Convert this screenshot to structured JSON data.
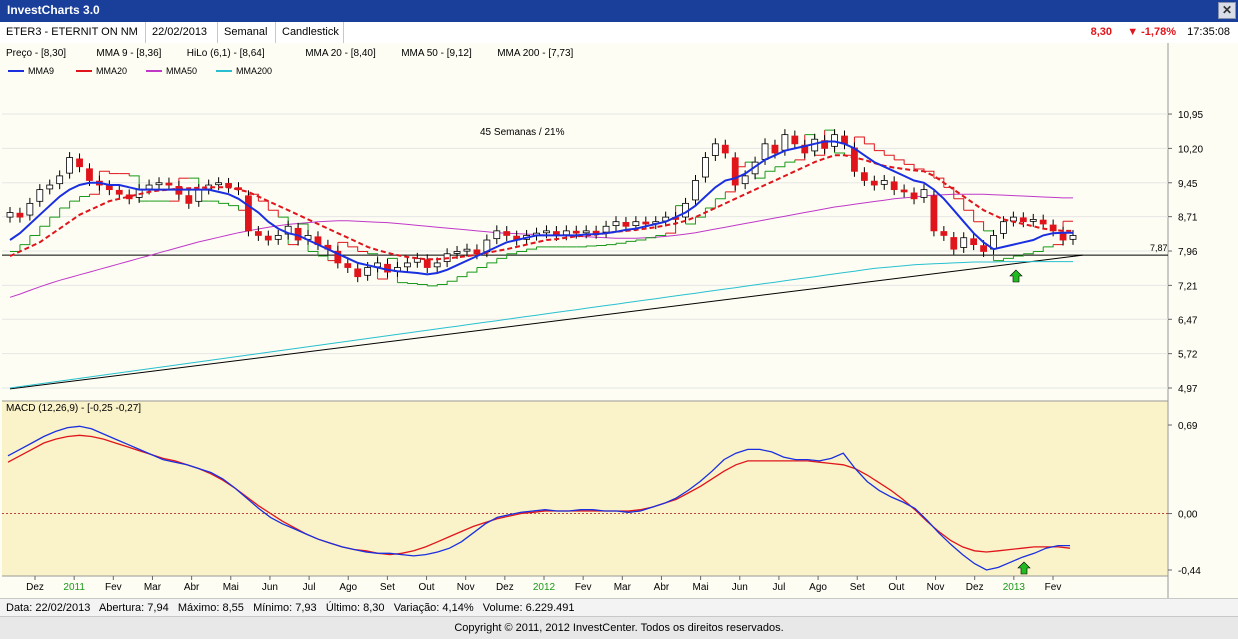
{
  "app": {
    "title": "InvestCharts 3.0",
    "close_glyph": "✕"
  },
  "toolbar": {
    "ticker": "ETER3 - ETERNIT ON NM",
    "date": "22/02/2013",
    "period": "Semanal",
    "chart_type": "Candlestick",
    "price": "8,30",
    "change": "▼ -1,78%",
    "time": "17:35:08"
  },
  "indicators_line": [
    "Preço - [8,30]",
    "MMA 9 - [8,36]",
    "HiLo (6,1) - [8,64]",
    "MMA 20 - [8,40]",
    "MMA 50 - [9,12]",
    "MMA 200 - [7,73]"
  ],
  "info_bar": {
    "data": "Data: 22/02/2013",
    "abertura": "Abertura: 7,94",
    "maximo": "Máximo: 8,55",
    "minimo": "Mínimo: 7,93",
    "ultimo": "Último: 8,30",
    "variacao": "Variação: 4,14%",
    "volume": "Volume: 6.229.491"
  },
  "copyright": "Copyright © 2011, 2012 InvestCenter. Todos os direitos reservados.",
  "colors": {
    "up": "#ffffff",
    "down": "#e0141b",
    "mma9": "#1a2fe0",
    "mma20": "#e0141b",
    "mma50": "#c038c8",
    "mma200": "#28c0d0",
    "hilo_up": "#1a9a1a",
    "hilo_down": "#e0141b",
    "macd": "#1a2fe0",
    "signal": "#e0141b",
    "accent": "#22bb22"
  },
  "chart_data": [
    {
      "type": "candlestick",
      "title": "",
      "legend": [
        {
          "name": "MMA9",
          "color": "#1a2fe0"
        },
        {
          "name": "MMA20",
          "color": "#e0141b"
        },
        {
          "name": "MMA50",
          "color": "#c038c8"
        },
        {
          "name": "MMA200",
          "color": "#28c0d0"
        }
      ],
      "annotation": "45 Semanas / 21%",
      "hline_label": "7,87",
      "hline_value": 7.87,
      "y_ticks": [
        "10,95",
        "10,20",
        "9,45",
        "8,71",
        "7,96",
        "7,21",
        "6,47",
        "5,72",
        "4,97"
      ],
      "ylim": [
        4.97,
        11.3
      ],
      "trendline": [
        [
          0,
          4.95
        ],
        [
          108,
          7.87
        ]
      ],
      "close": [
        8.8,
        8.7,
        9.0,
        9.3,
        9.4,
        9.6,
        10.0,
        9.8,
        9.5,
        9.4,
        9.3,
        9.2,
        9.1,
        9.3,
        9.4,
        9.45,
        9.4,
        9.2,
        9.0,
        9.3,
        9.4,
        9.45,
        9.35,
        9.3,
        8.4,
        8.3,
        8.2,
        8.3,
        8.5,
        8.2,
        8.3,
        8.1,
        8.0,
        7.7,
        7.6,
        7.4,
        7.6,
        7.7,
        7.5,
        7.6,
        7.7,
        7.8,
        7.6,
        7.7,
        7.9,
        7.95,
        8.0,
        7.9,
        8.2,
        8.4,
        8.3,
        8.2,
        8.3,
        8.35,
        8.4,
        8.3,
        8.4,
        8.35,
        8.4,
        8.35,
        8.5,
        8.6,
        8.5,
        8.6,
        8.55,
        8.6,
        8.7,
        8.65,
        9.0,
        9.5,
        10.0,
        10.3,
        10.1,
        9.4,
        9.6,
        9.9,
        10.3,
        10.1,
        10.5,
        10.3,
        10.1,
        10.4,
        10.2,
        10.5,
        10.3,
        9.7,
        9.5,
        9.4,
        9.5,
        9.3,
        9.25,
        9.1,
        9.3,
        8.4,
        8.3,
        8.0,
        8.25,
        8.1,
        7.95,
        8.3,
        8.6,
        8.7,
        8.6,
        8.65,
        8.55,
        8.4,
        8.2,
        8.3
      ],
      "mma9": [
        8.2,
        8.35,
        8.55,
        8.75,
        8.95,
        9.15,
        9.3,
        9.4,
        9.45,
        9.45,
        9.4,
        9.4,
        9.35,
        9.3,
        9.3,
        9.3,
        9.3,
        9.3,
        9.3,
        9.3,
        9.3,
        9.25,
        9.2,
        9.1,
        8.95,
        8.8,
        8.6,
        8.45,
        8.35,
        8.3,
        8.2,
        8.1,
        8.0,
        7.9,
        7.8,
        7.7,
        7.65,
        7.6,
        7.55,
        7.52,
        7.5,
        7.48,
        7.45,
        7.48,
        7.55,
        7.65,
        7.75,
        7.85,
        7.95,
        8.05,
        8.15,
        8.2,
        8.25,
        8.3,
        8.3,
        8.3,
        8.3,
        8.3,
        8.32,
        8.33,
        8.35,
        8.38,
        8.42,
        8.45,
        8.5,
        8.55,
        8.6,
        8.7,
        8.8,
        8.95,
        9.15,
        9.35,
        9.5,
        9.55,
        9.65,
        9.8,
        9.95,
        10.05,
        10.15,
        10.2,
        10.25,
        10.3,
        10.35,
        10.35,
        10.3,
        10.2,
        10.05,
        9.9,
        9.8,
        9.7,
        9.6,
        9.5,
        9.45,
        9.3,
        9.1,
        8.85,
        8.6,
        8.35,
        8.15,
        8.0,
        8.05,
        8.1,
        8.15,
        8.2,
        8.3,
        8.35,
        8.36,
        8.36
      ],
      "mma20": [
        7.85,
        7.95,
        8.05,
        8.15,
        8.3,
        8.45,
        8.6,
        8.75,
        8.85,
        8.95,
        9.05,
        9.1,
        9.15,
        9.2,
        9.25,
        9.28,
        9.3,
        9.32,
        9.33,
        9.34,
        9.35,
        9.35,
        9.35,
        9.3,
        9.25,
        9.15,
        9.05,
        8.95,
        8.85,
        8.75,
        8.65,
        8.55,
        8.45,
        8.35,
        8.25,
        8.15,
        8.05,
        7.98,
        7.92,
        7.87,
        7.83,
        7.8,
        7.78,
        7.78,
        7.8,
        7.82,
        7.85,
        7.88,
        7.92,
        7.96,
        8.0,
        8.05,
        8.1,
        8.15,
        8.2,
        8.22,
        8.25,
        8.28,
        8.3,
        8.32,
        8.35,
        8.38,
        8.4,
        8.42,
        8.45,
        8.48,
        8.52,
        8.56,
        8.62,
        8.7,
        8.8,
        8.9,
        9.0,
        9.1,
        9.2,
        9.3,
        9.4,
        9.5,
        9.6,
        9.7,
        9.8,
        9.9,
        9.98,
        10.05,
        10.05,
        10.0,
        9.95,
        9.88,
        9.82,
        9.78,
        9.75,
        9.72,
        9.7,
        9.6,
        9.45,
        9.3,
        9.15,
        9.0,
        8.85,
        8.75,
        8.65,
        8.6,
        8.55,
        8.5,
        8.45,
        8.42,
        8.4,
        8.4
      ],
      "mma50": [
        6.95,
        7.02,
        7.1,
        7.18,
        7.25,
        7.32,
        7.38,
        7.44,
        7.5,
        7.56,
        7.62,
        7.68,
        7.74,
        7.8,
        7.86,
        7.92,
        7.98,
        8.04,
        8.1,
        8.16,
        8.21,
        8.26,
        8.31,
        8.36,
        8.4,
        8.44,
        8.48,
        8.51,
        8.54,
        8.56,
        8.58,
        8.6,
        8.61,
        8.62,
        8.62,
        8.61,
        8.6,
        8.59,
        8.58,
        8.56,
        8.54,
        8.52,
        8.5,
        8.48,
        8.46,
        8.44,
        8.42,
        8.4,
        8.38,
        8.36,
        8.35,
        8.34,
        8.33,
        8.32,
        8.31,
        8.3,
        8.29,
        8.28,
        8.27,
        8.26,
        8.25,
        8.24,
        8.24,
        8.24,
        8.25,
        8.26,
        8.28,
        8.3,
        8.33,
        8.36,
        8.4,
        8.44,
        8.48,
        8.52,
        8.56,
        8.6,
        8.64,
        8.68,
        8.72,
        8.76,
        8.8,
        8.84,
        8.88,
        8.92,
        8.95,
        8.98,
        9.01,
        9.04,
        9.07,
        9.1,
        9.12,
        9.14,
        9.16,
        9.18,
        9.19,
        9.2,
        9.2,
        9.2,
        9.2,
        9.19,
        9.18,
        9.17,
        9.16,
        9.15,
        9.14,
        9.13,
        9.12,
        9.12
      ],
      "mma200": [
        4.97,
        5.0,
        5.03,
        5.06,
        5.09,
        5.12,
        5.15,
        5.18,
        5.21,
        5.24,
        5.27,
        5.3,
        5.33,
        5.36,
        5.39,
        5.42,
        5.45,
        5.48,
        5.51,
        5.54,
        5.57,
        5.6,
        5.63,
        5.66,
        5.69,
        5.72,
        5.75,
        5.78,
        5.81,
        5.84,
        5.87,
        5.9,
        5.93,
        5.96,
        5.99,
        6.02,
        6.05,
        6.08,
        6.11,
        6.14,
        6.17,
        6.2,
        6.23,
        6.26,
        6.29,
        6.32,
        6.35,
        6.38,
        6.41,
        6.44,
        6.47,
        6.5,
        6.53,
        6.56,
        6.59,
        6.62,
        6.65,
        6.68,
        6.71,
        6.74,
        6.77,
        6.8,
        6.83,
        6.86,
        6.89,
        6.92,
        6.95,
        6.98,
        7.01,
        7.04,
        7.07,
        7.1,
        7.13,
        7.16,
        7.19,
        7.22,
        7.25,
        7.28,
        7.31,
        7.34,
        7.37,
        7.4,
        7.43,
        7.46,
        7.49,
        7.52,
        7.55,
        7.58,
        7.6,
        7.62,
        7.64,
        7.66,
        7.67,
        7.68,
        7.69,
        7.7,
        7.71,
        7.72,
        7.72,
        7.72,
        7.73,
        7.73,
        7.73,
        7.73,
        7.73,
        7.73,
        7.73,
        7.73
      ]
    },
    {
      "type": "line",
      "title": "MACD (12,26,9) - [-0,25  -0,27]",
      "y_ticks": [
        "0,69",
        "0,00",
        "-0,44"
      ],
      "ylim": [
        -0.44,
        0.69
      ],
      "series": [
        {
          "name": "MACD",
          "values": [
            0.45,
            0.5,
            0.55,
            0.6,
            0.64,
            0.67,
            0.68,
            0.66,
            0.62,
            0.58,
            0.54,
            0.5,
            0.46,
            0.42,
            0.4,
            0.38,
            0.35,
            0.32,
            0.27,
            0.2,
            0.12,
            0.04,
            -0.03,
            -0.08,
            -0.12,
            -0.16,
            -0.2,
            -0.23,
            -0.26,
            -0.28,
            -0.3,
            -0.31,
            -0.31,
            -0.32,
            -0.33,
            -0.32,
            -0.3,
            -0.27,
            -0.22,
            -0.15,
            -0.08,
            -0.03,
            -0.01,
            0.01,
            0.02,
            0.03,
            0.02,
            0.02,
            0.03,
            0.03,
            0.02,
            0.02,
            0.01,
            0.02,
            0.05,
            0.08,
            0.12,
            0.18,
            0.25,
            0.33,
            0.42,
            0.47,
            0.5,
            0.5,
            0.48,
            0.44,
            0.42,
            0.42,
            0.41,
            0.43,
            0.47,
            0.35,
            0.25,
            0.18,
            0.13,
            0.09,
            0.04,
            -0.05,
            -0.15,
            -0.24,
            -0.32,
            -0.39,
            -0.44,
            -0.42,
            -0.38,
            -0.34,
            -0.31,
            -0.27,
            -0.25,
            -0.25
          ]
        },
        {
          "name": "Signal",
          "values": [
            0.4,
            0.45,
            0.5,
            0.55,
            0.58,
            0.6,
            0.61,
            0.6,
            0.58,
            0.55,
            0.52,
            0.49,
            0.46,
            0.43,
            0.41,
            0.38,
            0.35,
            0.31,
            0.26,
            0.2,
            0.13,
            0.06,
            0.0,
            -0.06,
            -0.11,
            -0.16,
            -0.2,
            -0.23,
            -0.26,
            -0.28,
            -0.29,
            -0.31,
            -0.32,
            -0.31,
            -0.29,
            -0.26,
            -0.22,
            -0.18,
            -0.14,
            -0.1,
            -0.07,
            -0.04,
            -0.02,
            0.0,
            0.01,
            0.02,
            0.02,
            0.02,
            0.02,
            0.02,
            0.02,
            0.02,
            0.02,
            0.03,
            0.05,
            0.08,
            0.11,
            0.16,
            0.21,
            0.27,
            0.33,
            0.38,
            0.41,
            0.41,
            0.41,
            0.41,
            0.41,
            0.41,
            0.4,
            0.39,
            0.38,
            0.35,
            0.3,
            0.24,
            0.18,
            0.11,
            0.03,
            -0.06,
            -0.14,
            -0.21,
            -0.26,
            -0.29,
            -0.3,
            -0.29,
            -0.28,
            -0.27,
            -0.26,
            -0.26,
            -0.26,
            -0.27
          ]
        }
      ]
    }
  ],
  "x_axis": [
    "Dez",
    "2011",
    "Fev",
    "Mar",
    "Abr",
    "Mai",
    "Jun",
    "Jul",
    "Ago",
    "Set",
    "Out",
    "Nov",
    "Dez",
    "2012",
    "Fev",
    "Mar",
    "Abr",
    "Mai",
    "Jun",
    "Jul",
    "Ago",
    "Set",
    "Out",
    "Nov",
    "Dez",
    "2013",
    "Fev"
  ]
}
